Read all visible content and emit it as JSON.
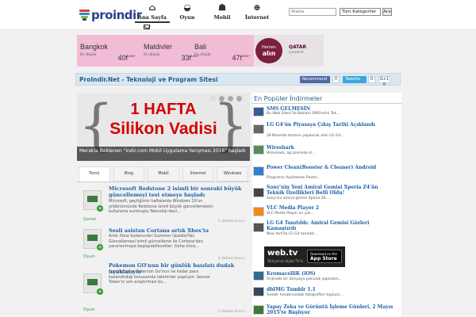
{
  "header": {
    "logo_text": "proindir",
    "nav": [
      {
        "label": "Ana Sayfa",
        "icon": "home-icon",
        "glyph": "⌂"
      },
      {
        "label": "Oyun",
        "icon": "gamepad-icon",
        "glyph": "◒"
      },
      {
        "label": "Mobil",
        "icon": "android-icon",
        "glyph": "☗"
      },
      {
        "label": "İnternet",
        "icon": "globe-icon",
        "glyph": "⊕"
      }
    ],
    "search_placeholder": "Arama",
    "category_selected": "Tüm Kategoriler",
    "search_button": "Ara"
  },
  "banner": {
    "cities": [
      {
        "name": "Bangkok",
        "label": "En düşük",
        "price": "40f",
        "unit": "USD*"
      },
      {
        "name": "Maldivler",
        "label": "En düşük",
        "price": "33f",
        "unit": "USD*"
      },
      {
        "name": "Bali",
        "label": "En düşük",
        "price": "47f",
        "unit": "USD*"
      }
    ],
    "cta_line1": "Hemen",
    "cta_line2": "alın",
    "airline": "QATAR",
    "airline_sub": "oneworld"
  },
  "titlebar": {
    "title": "ProIndir.Net - Teknoloji ve Program Sitesi",
    "fb_label": "Recommend",
    "fb_count": "0",
    "tw_label": "Tweetle",
    "tw_count": "0",
    "gplus": "G+1 0"
  },
  "slider": {
    "line1": "1 HAFTA",
    "line2": "Silikon Vadisi",
    "caption": "Merakla Beklenen \"indir.com Mobil Uygulama Yarışması 2016\" başladı"
  },
  "tabs": [
    "Tümü",
    "Blog",
    "Mobil",
    "İnternet",
    "Windows"
  ],
  "posts": [
    {
      "title": "Microsoft Redstone 2 isimli bir sonraki büyük güncellemeyi test etmeye başladı",
      "desc": "Microsoft, geçtiğimiz haftalarda Windows 10'un yıldönümünde Redstone isimli büyük güncellemesini kullanıma sunmuştu.Teknoloji devi...",
      "category": "Genel",
      "meta": "2 dakika önce"
    },
    {
      "title": "Sesli asistan Cortana artık Xbox'ta",
      "desc": "Artık Xbox kullanıcıları Summer Update/Yaz Güncellemesi isimli güncelleme ile Cortana'dan yararlanmaya başlayabilecekler. Daha önce...",
      "category": "Oyun",
      "meta": "2 dakika önce"
    },
    {
      "title": "Pokemon GO'nun bir günlük hasılatı dudak uçuklatıyor",
      "desc": "Popüler oyun Pokemon Go'nun ne kadar para kazandırdığı konusunda tahminler yapılıyor. Sensor Tower'ın son araştırması bu...",
      "category": "Oyun",
      "meta": "2 dakika önce"
    }
  ],
  "sidebar": {
    "heading": "En Popüler İndirmeler",
    "items": [
      {
        "title": "SMS GELMESİN",
        "desc": "Bu Web Sitesi İle Beklam SMS'lerini Tek..."
      },
      {
        "title": "LG G4'ün Piyasaya Çıkış Tarihi Açıklandı",
        "desc": "28 Nisanda tanıtımı yapılacak olan LG G4..."
      },
      {
        "title": "Wireshark",
        "desc": "Wireshark, ağ üzerinde ki..."
      },
      {
        "title": "Power Clean(Booster & Cleaner) Android",
        "desc": "Programın Açıklaması Power..."
      },
      {
        "title": "Sony'nin Yeni Amiral Gemisi Xperia Z4'ün Teknik Özellikleri Belli Oldu!",
        "desc": "Sony'nin amiral gemisi Xperia Z4..."
      },
      {
        "title": "VLC Media Player 2",
        "desc": "VLC Media Player en çok..."
      },
      {
        "title": "LG G4 Tanıtıldı: Amiral Gemisi Gözleri Kamaştırdı",
        "desc": "New York'ta LG G4 tanıtıldı..."
      },
      {
        "title": "KromacelliK (iOS)",
        "desc": "Orijinalik bir dünyaya yolculuk yaparken..."
      },
      {
        "title": "dbIMG Tumblr 1.1",
        "desc": "Tumblr hesabınızdaki fotoğrafları topluca..."
      },
      {
        "title": "Yapay Zeka ve Görüntü İşleme Günleri, 2 Mayıs 2015'te Başlıyor",
        "desc": ""
      }
    ],
    "ad": {
      "brand": "web.tv",
      "sub": "Türkiye'nin dijital TV'si",
      "store_small": "Download on the",
      "store_big": "App Store"
    }
  }
}
